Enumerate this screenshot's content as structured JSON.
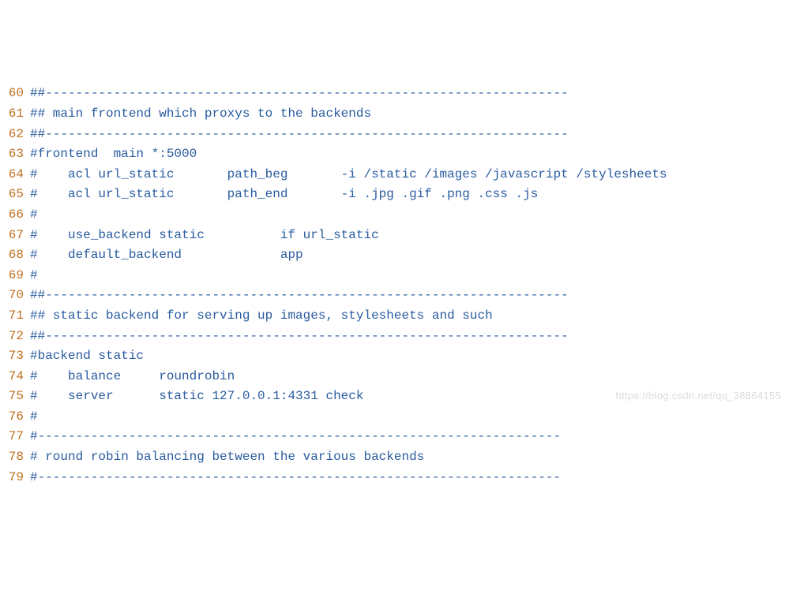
{
  "editor": {
    "first_line": 60,
    "lines": [
      "##---------------------------------------------------------------------",
      "## main frontend which proxys to the backends",
      "##---------------------------------------------------------------------",
      "#frontend  main *:5000",
      "#    acl url_static       path_beg       -i /static /images /javascript /stylesheets",
      "#    acl url_static       path_end       -i .jpg .gif .png .css .js",
      "#",
      "#    use_backend static          if url_static",
      "#    default_backend             app",
      "#",
      "##---------------------------------------------------------------------",
      "## static backend for serving up images, stylesheets and such",
      "##---------------------------------------------------------------------",
      "#backend static",
      "#    balance     roundrobin",
      "#    server      static 127.0.0.1:4331 check",
      "#",
      "#---------------------------------------------------------------------",
      "# round robin balancing between the various backends",
      "#---------------------------------------------------------------------"
    ]
  },
  "watermark": "https://blog.csdn.net/qq_38864155"
}
